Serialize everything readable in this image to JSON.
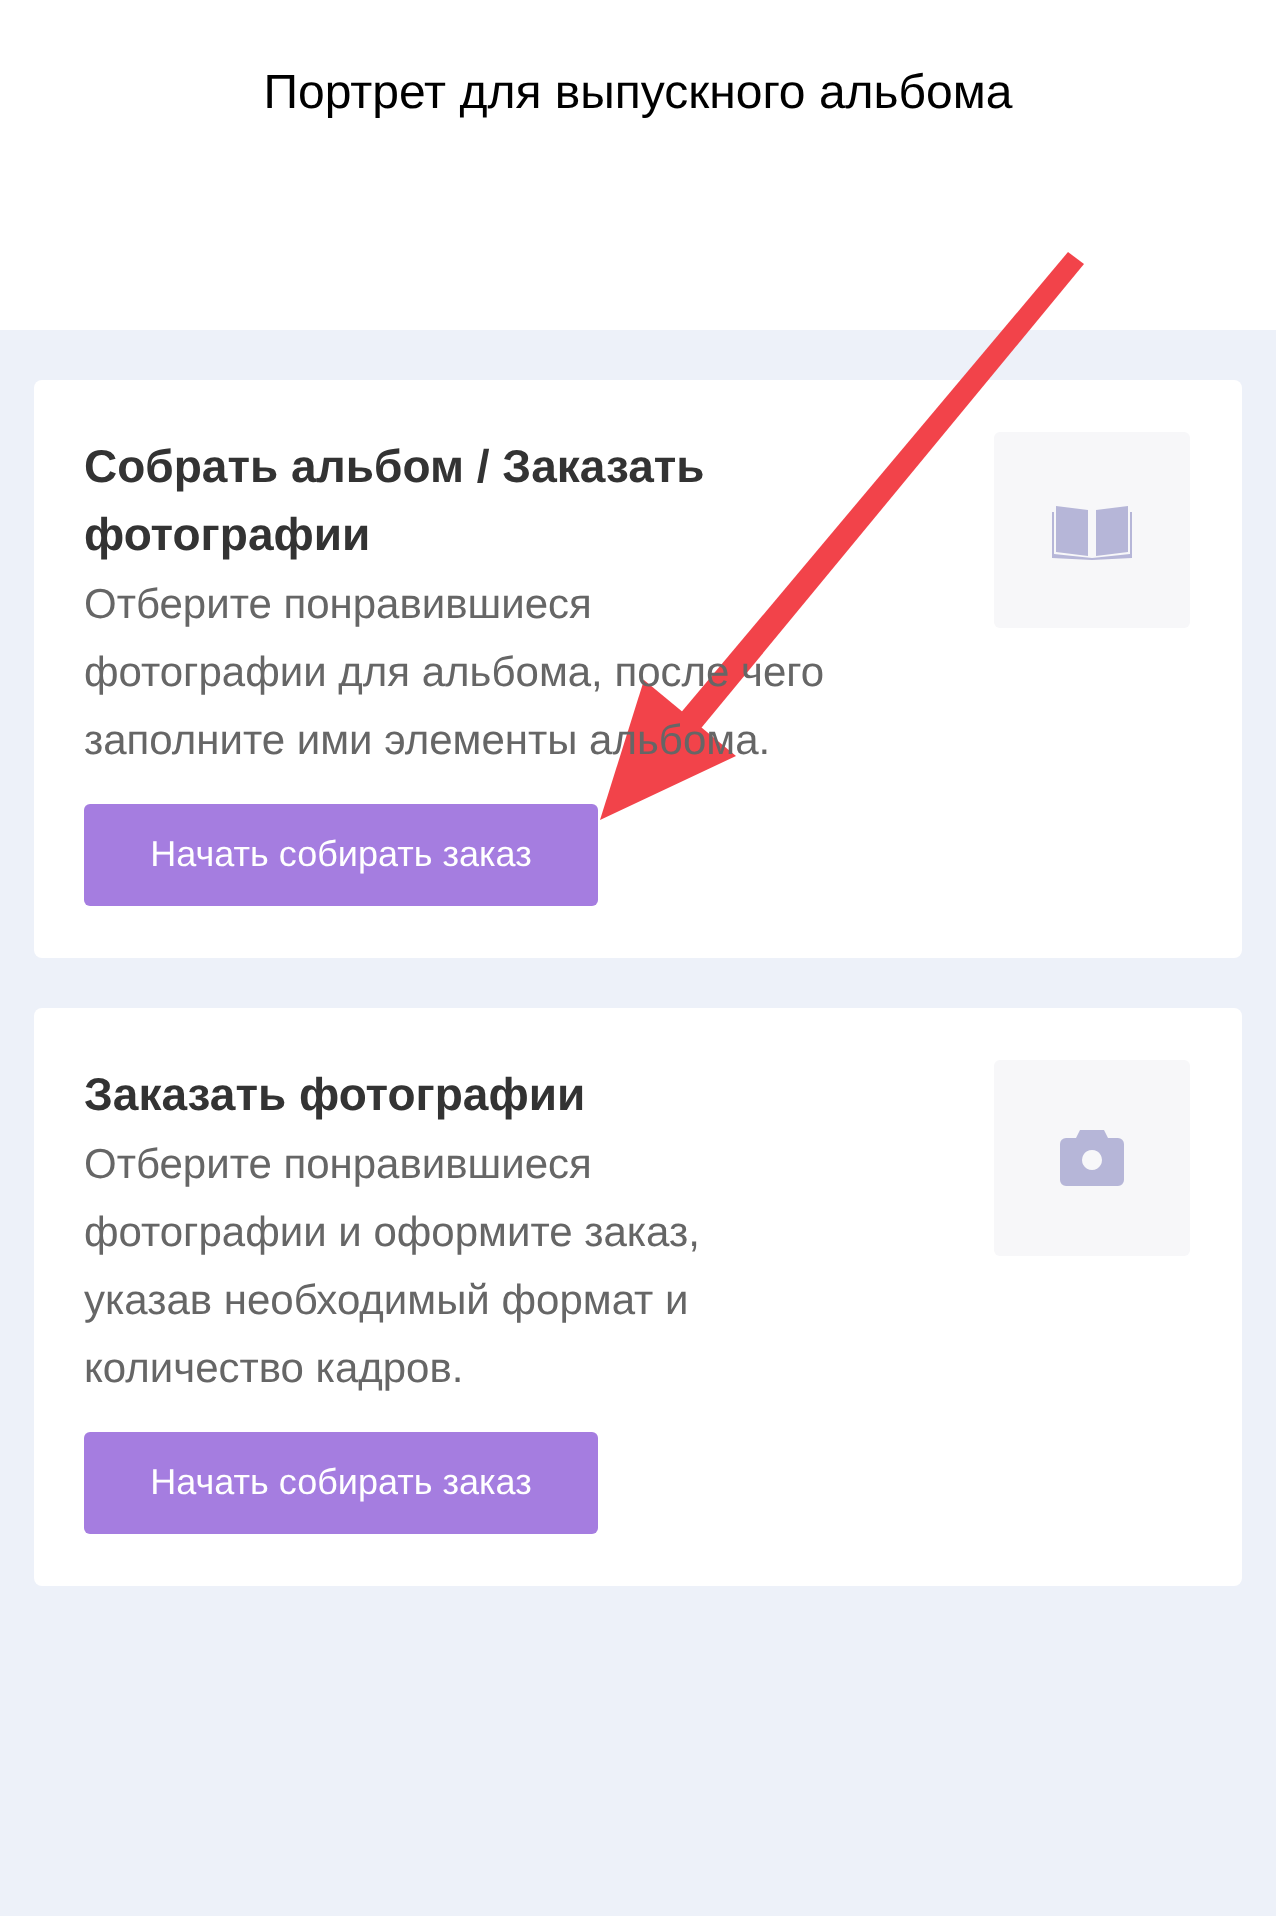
{
  "header": {
    "title": "Портрет для выпускного альбома"
  },
  "cards": [
    {
      "title": "Собрать альбом / Заказать фотографии",
      "description": "Отберите понравившиеся фотографии для альбома, после чего заполните ими элементы альбома.",
      "button": "Начать собирать заказ",
      "icon": {
        "kind": "book"
      }
    },
    {
      "title": "Заказать фотографии",
      "description": "Отберите понравившиеся фотографии и оформите заказ, указав необходимый формат и количество кадров.",
      "button": "Начать собирать заказ",
      "icon": {
        "kind": "camera"
      }
    }
  ]
}
